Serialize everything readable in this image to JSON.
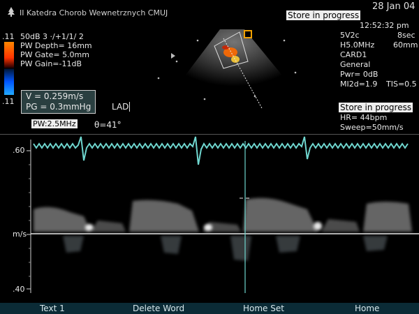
{
  "header": {
    "institution": "II Katedra Chorob Wewnetrznych CMUJ",
    "date": "28 Jan 04",
    "store_status": "Store in progress",
    "time": "12:52:32 pm"
  },
  "left_params": {
    "scale_top": ".11",
    "scale_bottom": ".11",
    "line1": "50dB  3 ·/+1/1/ 2",
    "line2": "PW Depth=  16mm",
    "line3": "PW Gate=  5.0mm",
    "line4": "PW Gain=-11dB"
  },
  "measurement": {
    "velocity": "V = 0.259m/s",
    "pressure_gradient": "PG = 0.3mmHg",
    "vessel_label": "LAD"
  },
  "right_params": {
    "probe": "5V2c",
    "time_window": "8sec",
    "harmonic": "H5.0MHz",
    "depth": "60mm",
    "preset": "CARD1",
    "mode": "General",
    "power": "Pwr=    0dB",
    "mi": "MI2d=1.9",
    "tis": "TIS=0.5",
    "store_status_2": "Store in progress",
    "heart_rate": "HR=  44bpm",
    "sweep": "Sweep=50mm/s"
  },
  "doppler": {
    "pw_freq": "PW:2.5MHz",
    "angle": "θ=41°",
    "scale_top": ".60",
    "baseline_unit": "m/s",
    "scale_bottom": ".40"
  },
  "softkeys": [
    "Text 1",
    "Delete Word",
    "Home Set",
    "Home"
  ],
  "colors": {
    "ecg": "#6fd6cf",
    "doppler_signal": "#c8c8c8",
    "color_bar_top": "#ff8800",
    "color_bar_bottom": "#2288ff",
    "softkey_bar": "#0b2b36"
  }
}
